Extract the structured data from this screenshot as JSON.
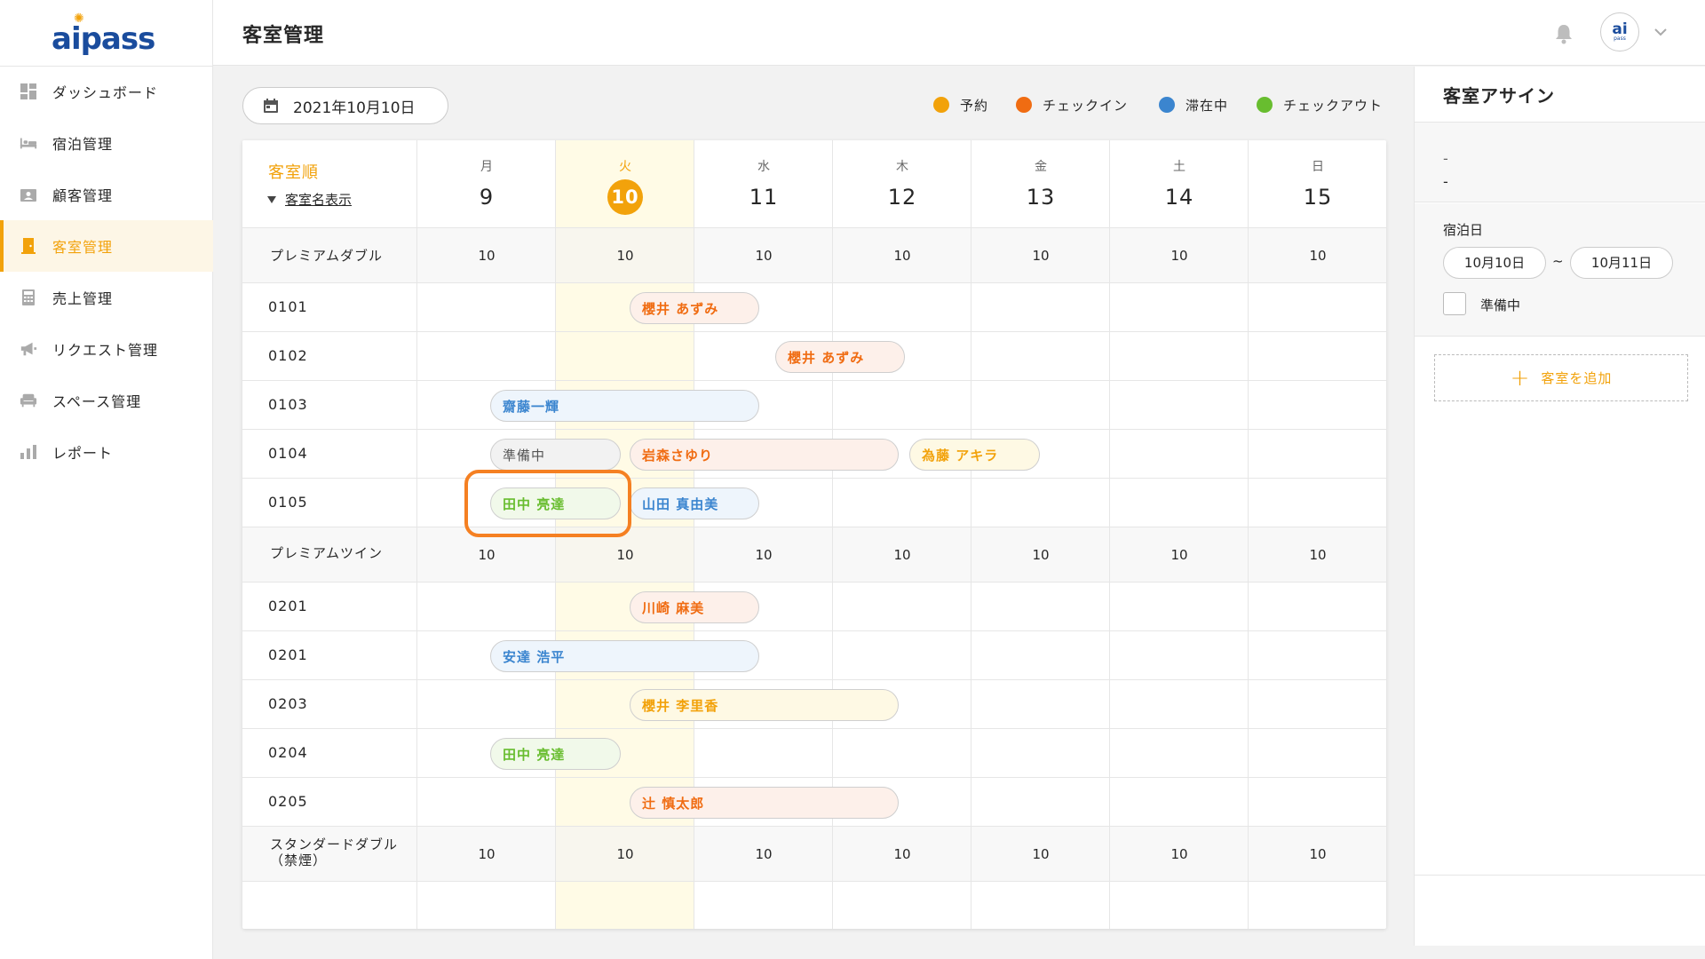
{
  "app": {
    "logo_text": "aipass",
    "avatar_text": "ai",
    "avatar_sub": "pass"
  },
  "header": {
    "title": "客室管理"
  },
  "sidebar": {
    "items": [
      {
        "label": "ダッシュボード",
        "icon": "dashboard-icon"
      },
      {
        "label": "宿泊管理",
        "icon": "bed-icon"
      },
      {
        "label": "顧客管理",
        "icon": "customer-card-icon"
      },
      {
        "label": "客室管理",
        "icon": "door-icon",
        "active": true
      },
      {
        "label": "売上管理",
        "icon": "calculator-icon"
      },
      {
        "label": "リクエスト管理",
        "icon": "megaphone-icon"
      },
      {
        "label": "スペース管理",
        "icon": "armchair-icon"
      },
      {
        "label": "レポート",
        "icon": "bar-chart-icon"
      }
    ]
  },
  "toolbar": {
    "date": "2021年10月10日"
  },
  "legend": [
    {
      "label": "予約",
      "color": "#f2a20b"
    },
    {
      "label": "チェックイン",
      "color": "#f06c12"
    },
    {
      "label": "滞在中",
      "color": "#3b85cf"
    },
    {
      "label": "チェックアウト",
      "color": "#68bd2f"
    }
  ],
  "calendar": {
    "sort_label": "客室順",
    "view_toggle": "客室名表示",
    "days": [
      {
        "weekday": "月",
        "day": "9"
      },
      {
        "weekday": "火",
        "day": "10",
        "today": true
      },
      {
        "weekday": "水",
        "day": "11"
      },
      {
        "weekday": "木",
        "day": "12"
      },
      {
        "weekday": "金",
        "day": "13"
      },
      {
        "weekday": "土",
        "day": "14"
      },
      {
        "weekday": "日",
        "day": "15"
      }
    ],
    "room_types": [
      {
        "name": "プレミアムダブル",
        "counts": [
          "10",
          "10",
          "10",
          "10",
          "10",
          "10",
          "10"
        ]
      },
      {
        "name": "プレミアムツイン",
        "counts": [
          "10",
          "10",
          "10",
          "10",
          "10",
          "10",
          "10"
        ]
      },
      {
        "name": "スタンダードダブル\n（禁煙）",
        "counts": [
          "10",
          "10",
          "10",
          "10",
          "10",
          "10",
          "10"
        ]
      }
    ],
    "rooms": [
      {
        "number": "0101"
      },
      {
        "number": "0102"
      },
      {
        "number": "0103"
      },
      {
        "number": "0104"
      },
      {
        "number": "0105"
      },
      {
        "number": "0201"
      },
      {
        "number": "0201"
      },
      {
        "number": "0203"
      },
      {
        "number": "0204"
      },
      {
        "number": "0205"
      }
    ],
    "bookings": [
      {
        "guest": "櫻井 あずみ",
        "status": "checkin"
      },
      {
        "guest": "櫻井 あずみ",
        "status": "checkin"
      },
      {
        "guest": "齋藤一輝",
        "status": "stay"
      },
      {
        "guest": "準備中",
        "status": "prep"
      },
      {
        "guest": "岩森さゆり",
        "status": "checkin"
      },
      {
        "guest": "為藤 アキラ",
        "status": "reserve"
      },
      {
        "guest": "田中 亮達",
        "status": "checkout"
      },
      {
        "guest": "山田 真由美",
        "status": "stay"
      },
      {
        "guest": "川崎 麻美",
        "status": "checkin"
      },
      {
        "guest": "安達 浩平",
        "status": "stay"
      },
      {
        "guest": "櫻井 李里香",
        "status": "reserve"
      },
      {
        "guest": "田中 亮達",
        "status": "checkout"
      },
      {
        "guest": "辻 慎太郎",
        "status": "checkin"
      }
    ]
  },
  "panel": {
    "title": "客室アサイン",
    "line1": "-",
    "line2": "-",
    "stay_label": "宿泊日",
    "date_from": "10月10日",
    "tilde": "~",
    "date_to": "10月11日",
    "prep_label": "準備中",
    "add_room": "客室を追加"
  }
}
